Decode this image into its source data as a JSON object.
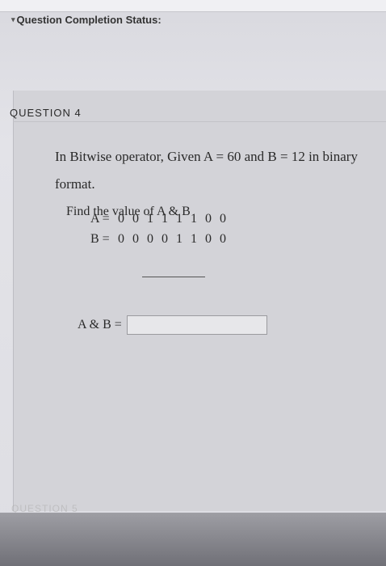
{
  "header": {
    "status_label": "Question Completion Status:",
    "status_icon": "chevron-down"
  },
  "question": {
    "title": "QUESTION 4",
    "text": "In Bitwise operator, Given A = 60 and B = 12 in binary format.",
    "prompt": "Find the value of A & B",
    "rows": [
      {
        "label": "A =",
        "value": "0 0 1 1 1 1 0 0"
      },
      {
        "label": "B =",
        "value": "0 0 0 0 1 1 0 0"
      }
    ],
    "answer_label": "A & B =",
    "answer_value": ""
  },
  "footer": {
    "next_question": "QUESTION 5"
  }
}
